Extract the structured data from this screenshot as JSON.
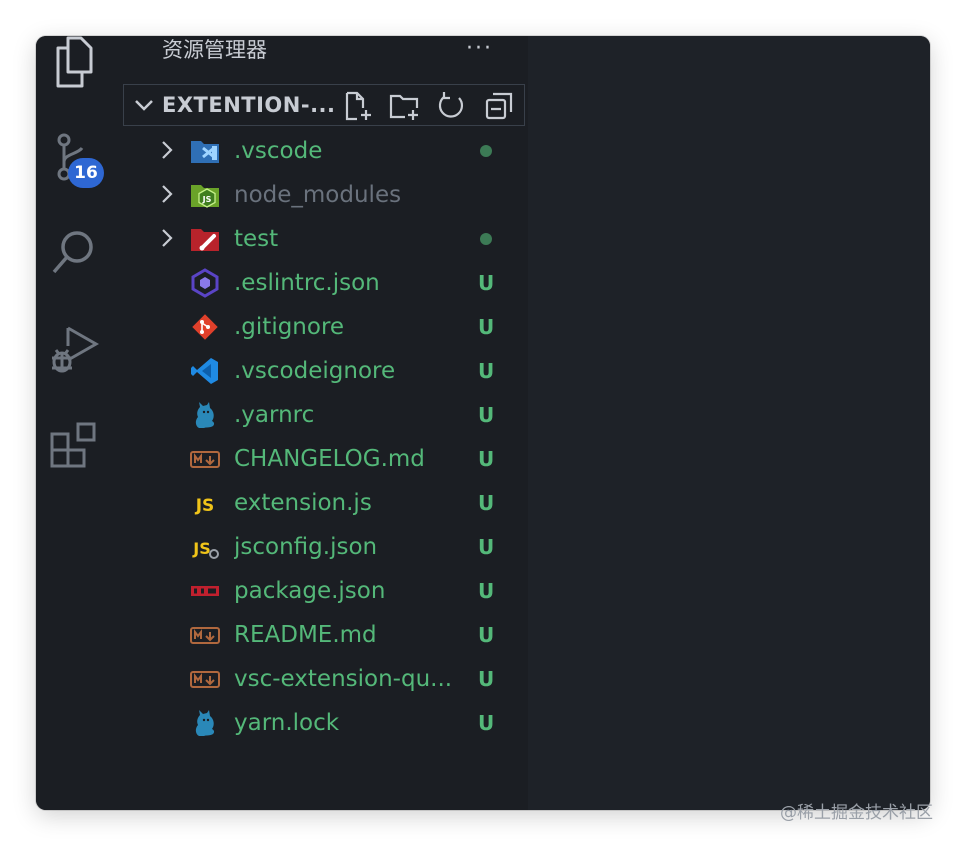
{
  "sidebar": {
    "title": "资源管理器",
    "more": "···",
    "section_label": "EXTENTION-...",
    "items": [
      {
        "name": ".vscode",
        "status": "",
        "dot": true,
        "folder": true,
        "dim": false,
        "icon": "vscode-folder-icon"
      },
      {
        "name": "node_modules",
        "status": "",
        "dot": false,
        "folder": true,
        "dim": true,
        "icon": "node-folder-icon"
      },
      {
        "name": "test",
        "status": "",
        "dot": true,
        "folder": true,
        "dim": false,
        "icon": "test-folder-icon"
      },
      {
        "name": ".eslintrc.json",
        "status": "U",
        "dot": false,
        "folder": false,
        "dim": false,
        "icon": "eslint-icon"
      },
      {
        "name": ".gitignore",
        "status": "U",
        "dot": false,
        "folder": false,
        "dim": false,
        "icon": "git-icon"
      },
      {
        "name": ".vscodeignore",
        "status": "U",
        "dot": false,
        "folder": false,
        "dim": false,
        "icon": "vscode-icon"
      },
      {
        "name": ".yarnrc",
        "status": "U",
        "dot": false,
        "folder": false,
        "dim": false,
        "icon": "yarn-icon"
      },
      {
        "name": "CHANGELOG.md",
        "status": "U",
        "dot": false,
        "folder": false,
        "dim": false,
        "icon": "markdown-icon"
      },
      {
        "name": "extension.js",
        "status": "U",
        "dot": false,
        "folder": false,
        "dim": false,
        "icon": "javascript-icon"
      },
      {
        "name": "jsconfig.json",
        "status": "U",
        "dot": false,
        "folder": false,
        "dim": false,
        "icon": "jsconfig-icon"
      },
      {
        "name": "package.json",
        "status": "U",
        "dot": false,
        "folder": false,
        "dim": false,
        "icon": "npm-icon"
      },
      {
        "name": "README.md",
        "status": "U",
        "dot": false,
        "folder": false,
        "dim": false,
        "icon": "markdown-icon"
      },
      {
        "name": "vsc-extension-qu...",
        "status": "U",
        "dot": false,
        "folder": false,
        "dim": false,
        "icon": "markdown-icon"
      },
      {
        "name": "yarn.lock",
        "status": "U",
        "dot": false,
        "folder": false,
        "dim": false,
        "icon": "yarn-icon"
      }
    ]
  },
  "activity": {
    "scm_badge": "16",
    "icons": [
      "explorer-icon",
      "source-control-icon",
      "search-icon",
      "run-debug-icon",
      "extensions-icon"
    ]
  },
  "colors": {
    "untracked": "#54b879",
    "badge": "#2e67d3",
    "background": "#1e2228"
  },
  "watermark": "@稀土掘金技术社区"
}
